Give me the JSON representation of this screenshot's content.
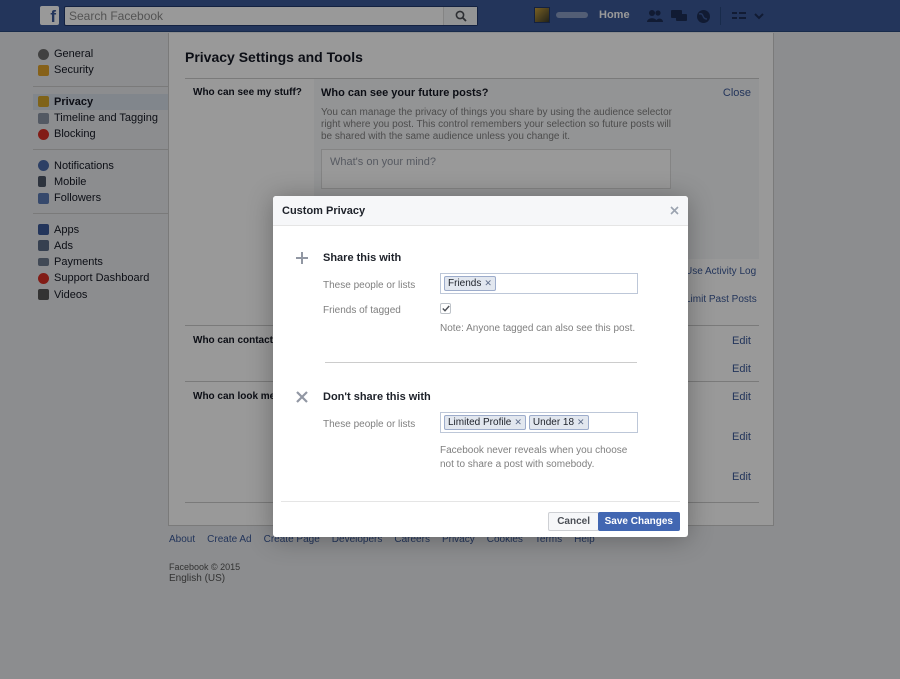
{
  "topbar": {
    "logo": "f",
    "search_placeholder": "Search Facebook",
    "home_label": "Home"
  },
  "sidebar": {
    "groups": [
      [
        {
          "label": "General",
          "icon": "gear-icon",
          "color": "#6d6d6d"
        },
        {
          "label": "Security",
          "icon": "lock-icon",
          "color": "#e0a22a"
        }
      ],
      [
        {
          "label": "Privacy",
          "icon": "privacy-lock-icon",
          "color": "#d4a62a",
          "active": true
        },
        {
          "label": "Timeline and Tagging",
          "icon": "timeline-icon",
          "color": "#8a94a6"
        },
        {
          "label": "Blocking",
          "icon": "block-icon",
          "color": "#d93025"
        }
      ],
      [
        {
          "label": "Notifications",
          "icon": "globe-icon",
          "color": "#4a6aa8"
        },
        {
          "label": "Mobile",
          "icon": "mobile-icon",
          "color": "#4b5566"
        },
        {
          "label": "Followers",
          "icon": "rss-icon",
          "color": "#5b7bb5"
        }
      ],
      [
        {
          "label": "Apps",
          "icon": "apps-icon",
          "color": "#3b5998"
        },
        {
          "label": "Ads",
          "icon": "ads-icon",
          "color": "#5b6b85"
        },
        {
          "label": "Payments",
          "icon": "card-icon",
          "color": "#6d7a8e"
        },
        {
          "label": "Support Dashboard",
          "icon": "lifebuoy-icon",
          "color": "#d93025"
        },
        {
          "label": "Videos",
          "icon": "film-icon",
          "color": "#555"
        }
      ]
    ]
  },
  "content": {
    "title": "Privacy Settings and Tools",
    "sections": [
      {
        "label": "Who can see my stuff?"
      },
      {
        "label": "Who can contact me?"
      },
      {
        "label": "Who can look me up?"
      }
    ],
    "future": {
      "title": "Who can see your future posts?",
      "close": "Close",
      "desc_prefix": "You can manage the privacy of things you share by using the audience selector ",
      "desc_link": "right where you post",
      "desc_suffix": ". This control remembers your selection so future posts will be shared with the same audience unless you change it.",
      "composer_placeholder": "What's on your mind?"
    },
    "use_activity_log": "Use Activity Log",
    "limit_past_posts": "Limit Past Posts",
    "edit": "Edit"
  },
  "footer": {
    "links": [
      "About",
      "Create Ad",
      "Create Page",
      "Developers",
      "Careers",
      "Privacy",
      "Cookies",
      "Terms",
      "Help"
    ],
    "copyright": "Facebook © 2015",
    "language": "English (US)"
  },
  "dialog": {
    "title": "Custom Privacy",
    "share": {
      "heading": "Share this with",
      "people_label": "These people or lists",
      "tokens": [
        "Friends"
      ],
      "tagged_label": "Friends of tagged",
      "tagged_checked": true,
      "note": "Note: Anyone tagged can also see this post."
    },
    "dont_share": {
      "heading": "Don't share this with",
      "people_label": "These people or lists",
      "tokens": [
        "Limited Profile",
        "Under 18"
      ],
      "note": "Facebook never reveals when you choose not to share a post with somebody."
    },
    "cancel": "Cancel",
    "save": "Save Changes"
  },
  "colors": {
    "brand": "#3b5998",
    "primary_button": "#4267b2"
  }
}
